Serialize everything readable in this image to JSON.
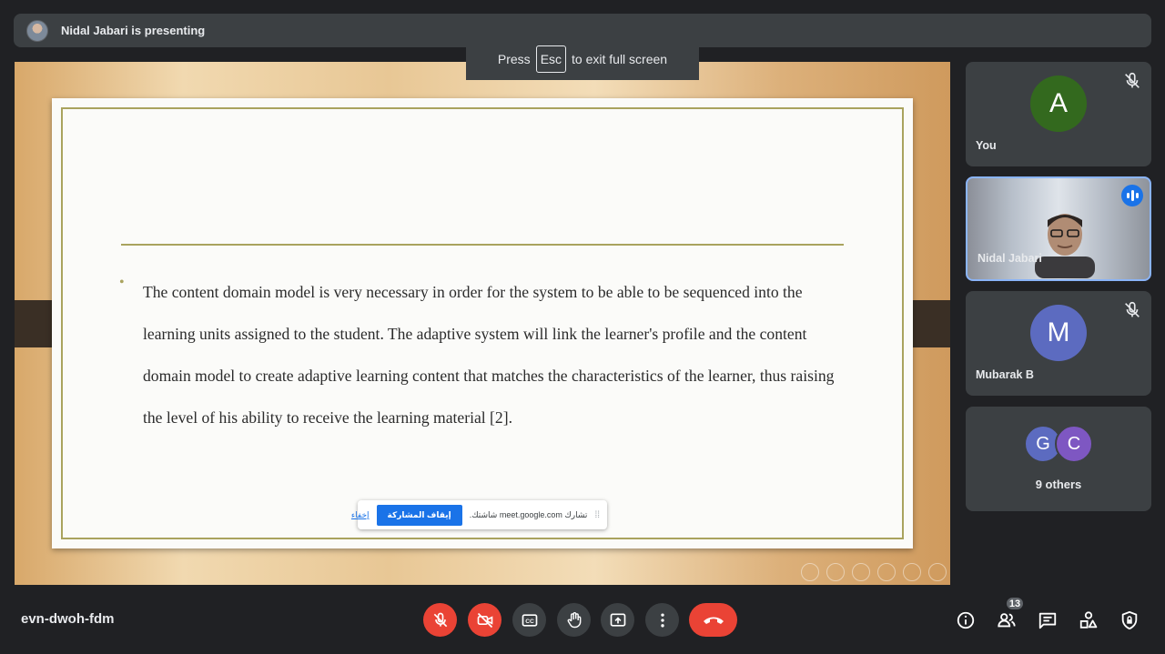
{
  "presenting_bar": {
    "text": "Nidal Jabari is presenting"
  },
  "esc_toast": {
    "press": "Press",
    "key": "Esc",
    "suffix": "to exit full screen"
  },
  "slide": {
    "bullet_text": "The content domain model is very necessary in order for the system to be able to be sequenced into the learning units assigned to the student. The adaptive system will link the learner's profile and the content domain model to create adaptive learning content that matches the characteristics of the learner, thus raising the level of his ability to receive the learning material [2]."
  },
  "share_notice": {
    "message": "تشارك meet.google.com شاشتك.",
    "stop_button": "إيقاف المشاركة",
    "hide_link": "إخفاء"
  },
  "participants": [
    {
      "name": "You",
      "initial": "A",
      "color": "#33691e",
      "muted": true
    },
    {
      "name": "Nidal Jabari",
      "video": true,
      "speaking": true
    },
    {
      "name": "Mubarak B",
      "initial": "M",
      "color": "#5c6bc0",
      "muted": true
    }
  ],
  "others": {
    "label": "9 others",
    "initials": [
      "G",
      "C"
    ],
    "colors": [
      "#5c6bc0",
      "#7e57c2"
    ]
  },
  "meeting": {
    "code": "evn-dwoh-fdm"
  },
  "people_count": "13",
  "colors": {
    "background": "#202124",
    "tile": "#3c4043",
    "danger": "#ea4335",
    "accent": "#8ab4f8"
  }
}
